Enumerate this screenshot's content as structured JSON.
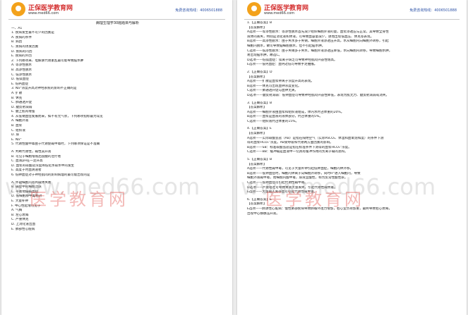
{
  "header": {
    "brand": "正保医学教育网",
    "url": "www.med66.com",
    "hotline": "免费咨询热线：4006501888"
  },
  "watermark": {
    "text": "医学教育网",
    "url": "www.med66.com"
  },
  "left": {
    "title": "病理生理学30题题目与解析",
    "lines": [
      "一、A1",
      "1. 疾病发生最不可少的因素是",
      "A. 疾病的条件",
      "B. 病因",
      "C. 疾病的诱发因素",
      "D. 疾病的内因",
      "E. 疾病的外因",
      "2. 下列哪项来、电解质代谢紊乱最可能导致脑水肿",
      "A. 等渗性脱水",
      "B. 高渗性脱水",
      "C. 低渗性脱水",
      "D. 低镁血症",
      "E. 低钙血症",
      "3. Na⁺浓度升高对神经系统的影响不正确的是",
      "A. 扩散",
      "B. 休克",
      "C. 肺通透升促",
      "D. 腱反射减弱",
      "E. 腱上肌肉增强",
      "4. 从低钠血症发展而来，如不有无气状，下列哪项指标最为常见",
      "A. 细胞外液",
      "B. 血浆",
      "C. 组织液",
      "D. 尿",
      "E. Na⁺",
      "5. 代谢性酸中毒由于代谢使碱中毒时，下列哪项保证是不准确",
      "",
      "A. 判断代谢性，碱性其升高",
      "B. 可见于细胞增殖后剖腹的治疗者",
      "C. 血液pH在一定升高",
      "D. 血浆的碳酸盐浓度降低化水碳水中的发生",
      "E. 高度子时血清速者",
      "6. 低钾血症对于神经肌肉的影响病理的最可能出现的是",
      "",
      "A. 怀疑细胞内有钙碱体失衡",
      "B. 碱症中的细胞活跃",
      "C. 平衡地偏碱血症",
      "D. 低细胞静中毒相对",
      "E. 大量补钾",
      "F. 中心性起增可见于",
      "A. 气胸",
      "B. 左心衰竭",
      "C. 严重休克",
      "D. 上消化道出血",
      "E. 肺部性心脏病"
    ]
  },
  "right": {
    "lines": [
      "1.【正确答案】B",
      "【答案解析】",
      "A选项——等渗性脱水：等渗性脱水首先减少组织细胞外液的量，血浆渗透压与正常，其导致全身性",
      "液体的丢失，特别是消化液和体液，可导致血容量减少，进而出现低血压、休克等表现。",
      "B选项——高渗性脱水：由于失水多于失钠，细胞外液渗透压升高，水从细胞内向细胞外转移，引起",
      "细胞内脱水，故可导致脑细胞脱水，但不引起脑水肿。",
      "C选项——低渗性脱水：由于失钠多于失水，细胞外液渗透压降低，水向细胞内转移，导致细胞水肿，",
      "易出现脑水肿，故选C。",
      "D选项——低镁血症：镁离子缺乏可导致神经肌肉兴奋性增高。",
      "E选项——低钙血症：血钙过低可导致手足抽搐。",
      "",
      "2.【正确答案】D",
      "【答案解析】",
      "A选项——扩散是血浆钾离子浓度升高的表现。",
      "B选项——休克可出现血钾浓度变化。",
      "C选项——肺通透升促与血钾无关。",
      "D选项——腱反射减弱：低钾血症可导致神经肌肉兴奋性降低，表现为肌无力、腱反射减弱或消失。",
      "",
      "3.【正确答案】B",
      "【答案解析】",
      "A选项——细胞外液由血浆和组织液组成，体内水约占体重的20%。",
      "B选项——血浆是血液的液体部分，约占体重的5%。",
      "C选项——组织液约占体重的15%。",
      "",
      "4.【正确答案】E",
      "【答案解析】",
      "A选项——实际碳酸氢盐（AB）是指在隔绝空气（实际PaCO₂、体温和血氧饱和度）的条件下测",
      "得的血浆HCO₃⁻浓度。AB受呼吸和代谢两方面因素的影响。",
      "B选项——SB：标准碳酸氢盐是指在标准条件下测得的血浆HCO₃⁻浓度。",
      "C选项——BB：缓冲碱是血液中一切具有缓冲作用的负离子碱的总和。",
      "",
      "5.【正确答案】B",
      "【答案解析】",
      "A选项——代谢性碱中毒，可见于大量补钾引起低钾血症，细胞内钾外移。",
      "B选项——低钾血症时，细胞内钾离子向细胞外转移，同时H⁺进入细胞内，导致",
      "细胞外液碱中毒，而细胞内酸中毒，尿液呈酸性，称为反常性酸性尿。",
      "C选项——低钾血症可引起代谢性碱中毒。",
      "D选项——严重呕吐可导致胃液大量丢失，引起代谢性碱中毒。",
      "E选项——大量输入库存血可引起代谢性碱中毒。",
      "",
      "6.【正确答案】E",
      "【答案解析】",
      "E选项——肺源性心脏病：慢性肺部疾病导致肺循环阻力增加，右心室负荷加重，最终导致右心衰竭，",
      "出现中心静脉压升高。"
    ]
  }
}
